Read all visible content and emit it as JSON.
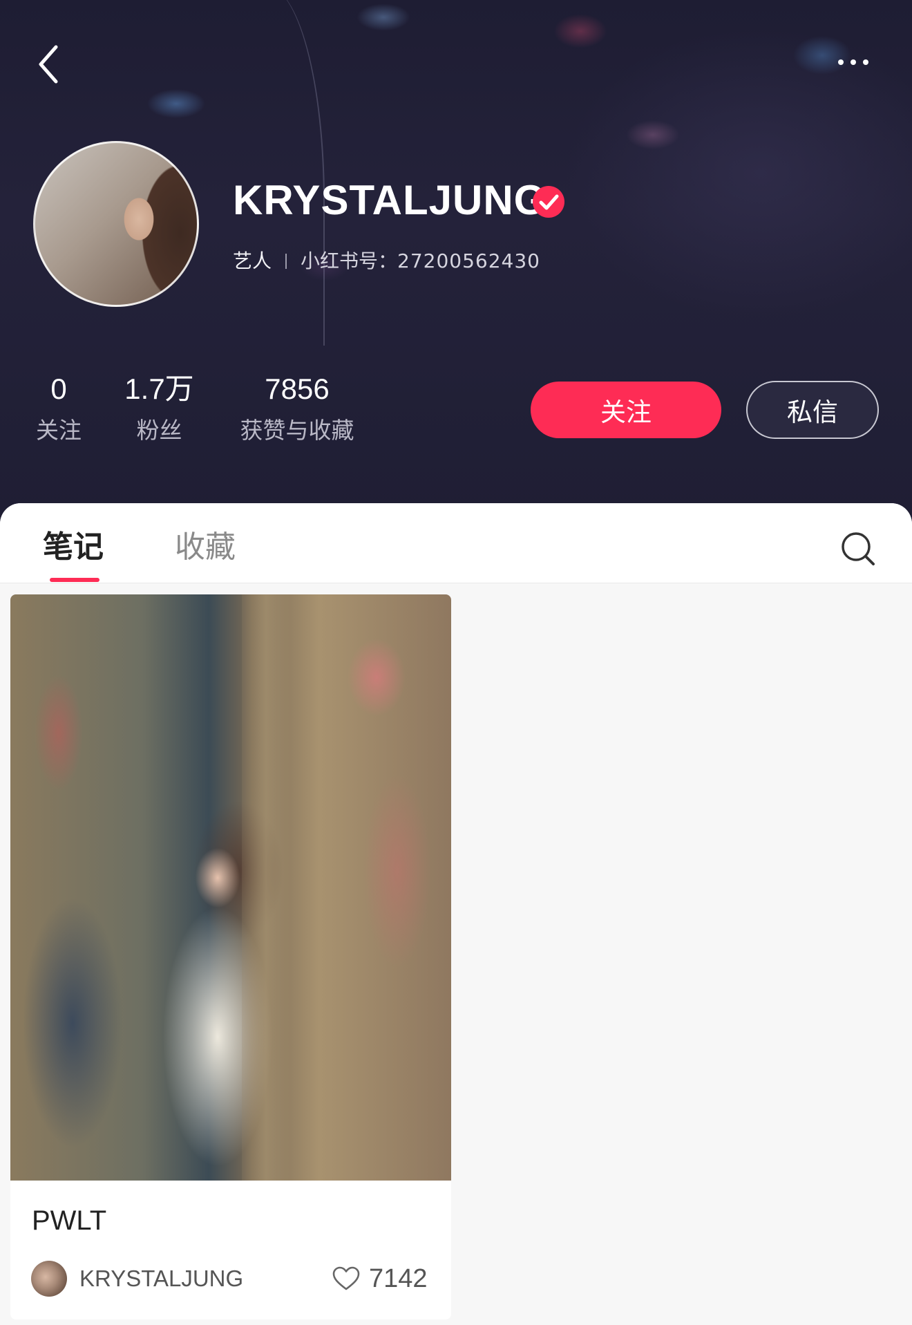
{
  "header": {
    "back_icon": "chevron-left-icon",
    "more_icon": "more-horizontal-icon"
  },
  "profile": {
    "name": "KRYSTALJUNG",
    "verified": true,
    "role": "艺人",
    "id_label": "小红书号：",
    "id_value": "27200562430",
    "accent_color": "#fe2c55"
  },
  "stats": [
    {
      "value": "0",
      "label": "关注"
    },
    {
      "value": "1.7万",
      "label": "粉丝"
    },
    {
      "value": "7856",
      "label": "获赞与收藏"
    }
  ],
  "actions": {
    "follow_label": "关注",
    "message_label": "私信"
  },
  "tabs": {
    "items": [
      {
        "label": "笔记",
        "active": true
      },
      {
        "label": "收藏",
        "active": false
      }
    ],
    "search_icon": "search-icon"
  },
  "notes": [
    {
      "title": "PWLT",
      "author": "KRYSTALJUNG",
      "likes": "7142"
    }
  ]
}
